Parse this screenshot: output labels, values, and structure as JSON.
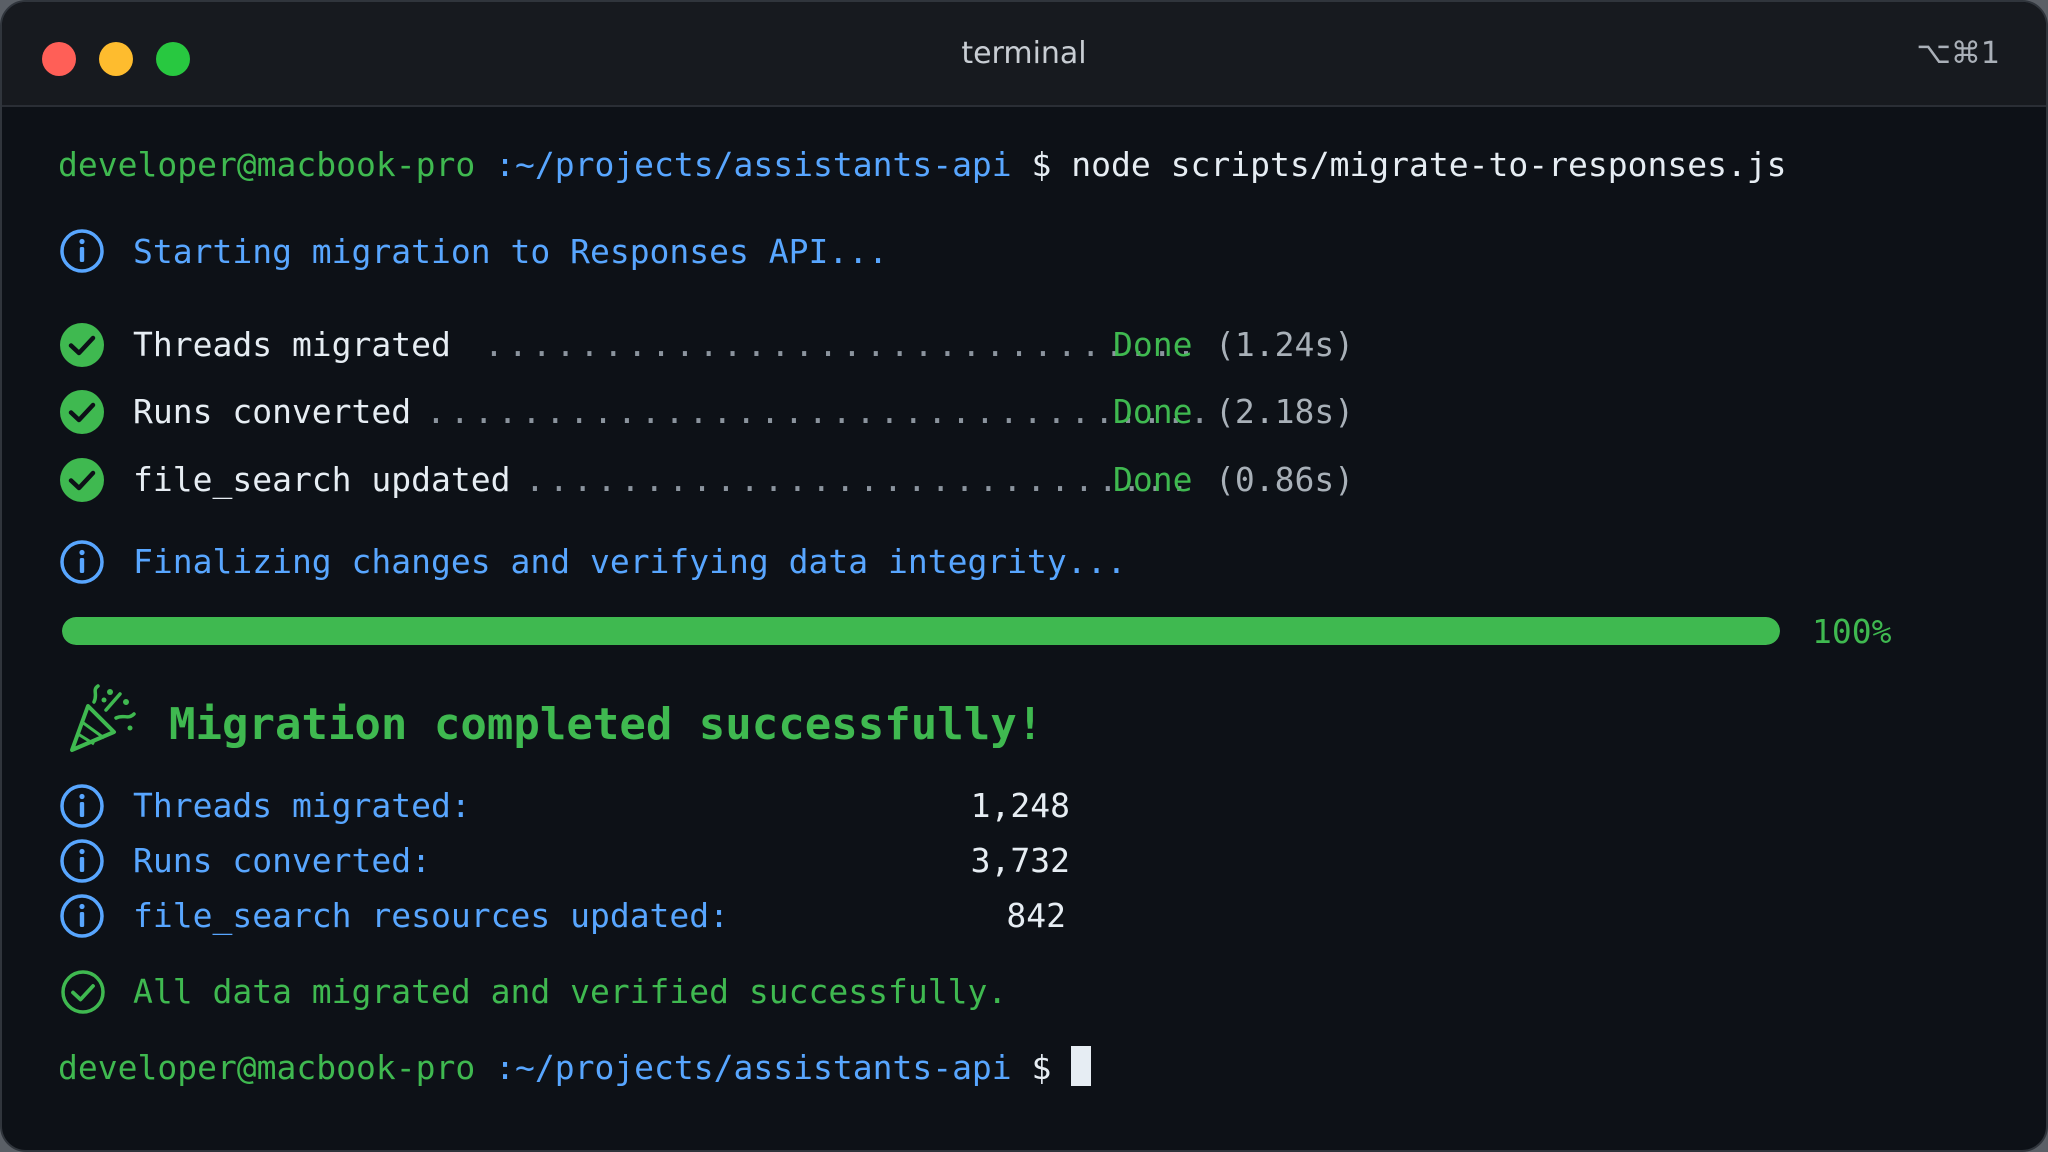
{
  "window": {
    "title": "terminal",
    "shortcut": "⌥⌘1"
  },
  "prompt": {
    "user_host": "developer@macbook-pro",
    "path": ":~/projects/assistants-api",
    "symbol": "$",
    "command": "node scripts/migrate-to-responses.js"
  },
  "output": {
    "start_message": "Starting migration to Responses API...",
    "steps": [
      {
        "label": "Threads migrated",
        "dots": "..............................",
        "status": "Done",
        "time": "(1.24s)"
      },
      {
        "label": "Runs converted",
        "dots": ".................................",
        "status": "Done",
        "time": "(2.18s)"
      },
      {
        "label": "file_search updated",
        "dots": "............................",
        "status": "Done",
        "time": "(0.86s)"
      }
    ],
    "finalizing_message": "Finalizing changes and verifying data integrity...",
    "progress": {
      "percent_label": "100%",
      "value": 1.0
    },
    "success_title": "Migration completed successfully!",
    "stats": [
      {
        "label": "Threads migrated:",
        "value": "1,248"
      },
      {
        "label": "Runs converted:",
        "value": "3,732"
      },
      {
        "label": "file_search resources updated:",
        "value": "842"
      }
    ],
    "final_message": "All data migrated and verified successfully."
  },
  "icons": {
    "info": "info-circle-icon",
    "check": "check-circle-icon",
    "party": "party-popper-icon"
  },
  "colors": {
    "background": "#0d1117",
    "green": "#3fb950",
    "blue": "#58a6ff",
    "text": "#e6edf3"
  }
}
